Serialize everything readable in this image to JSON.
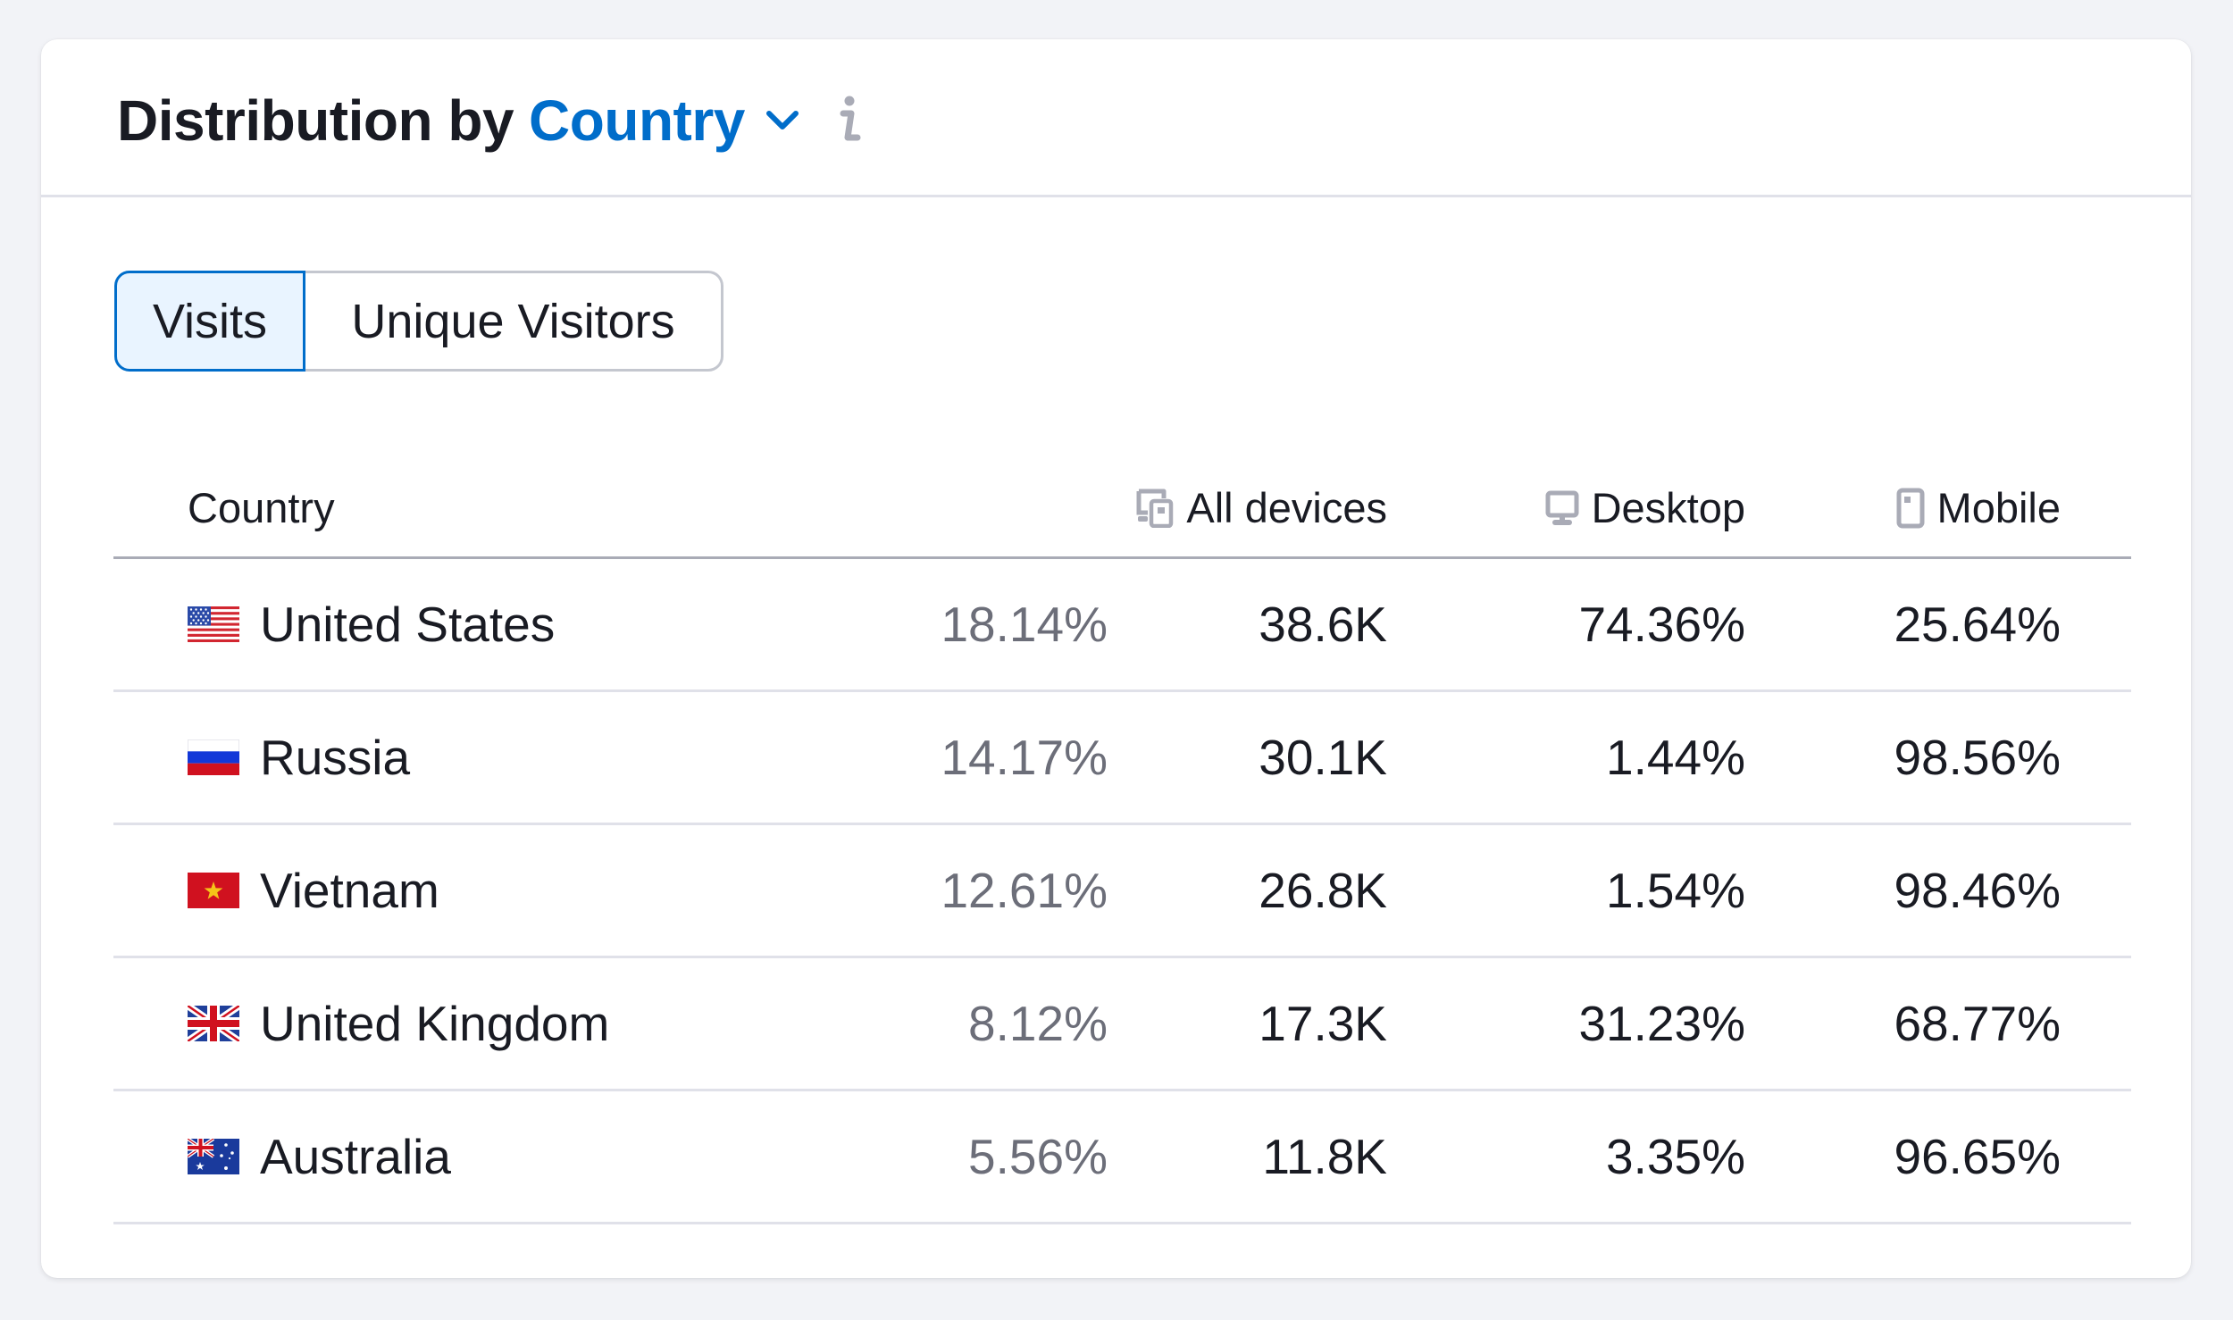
{
  "widget": {
    "title_prefix": "Distribution by",
    "title_dropdown": "Country",
    "dropdown_icon": "chevron-down-icon",
    "info_icon": "info-icon",
    "accent_color": "#006dca"
  },
  "toggle": {
    "options": [
      {
        "label": "Visits",
        "selected": true
      },
      {
        "label": "Unique Visitors",
        "selected": false
      }
    ]
  },
  "table": {
    "columns": [
      {
        "label": "Country",
        "icon": null
      },
      {
        "label": "All devices",
        "icon": "all-devices-icon"
      },
      {
        "label": "Desktop",
        "icon": "desktop-icon"
      },
      {
        "label": "Mobile",
        "icon": "mobile-icon"
      }
    ],
    "rows": [
      {
        "country": "United States",
        "flag": "us-flag-icon",
        "share": "18.14%",
        "all_devices": "38.6K",
        "desktop": "74.36%",
        "mobile": "25.64%"
      },
      {
        "country": "Russia",
        "flag": "russia-flag-icon",
        "share": "14.17%",
        "all_devices": "30.1K",
        "desktop": "1.44%",
        "mobile": "98.56%"
      },
      {
        "country": "Vietnam",
        "flag": "vietnam-flag-icon",
        "share": "12.61%",
        "all_devices": "26.8K",
        "desktop": "1.54%",
        "mobile": "98.46%"
      },
      {
        "country": "United Kingdom",
        "flag": "uk-flag-icon",
        "share": "8.12%",
        "all_devices": "17.3K",
        "desktop": "31.23%",
        "mobile": "68.77%"
      },
      {
        "country": "Australia",
        "flag": "australia-flag-icon",
        "share": "5.56%",
        "all_devices": "11.8K",
        "desktop": "3.35%",
        "mobile": "96.65%"
      }
    ]
  }
}
